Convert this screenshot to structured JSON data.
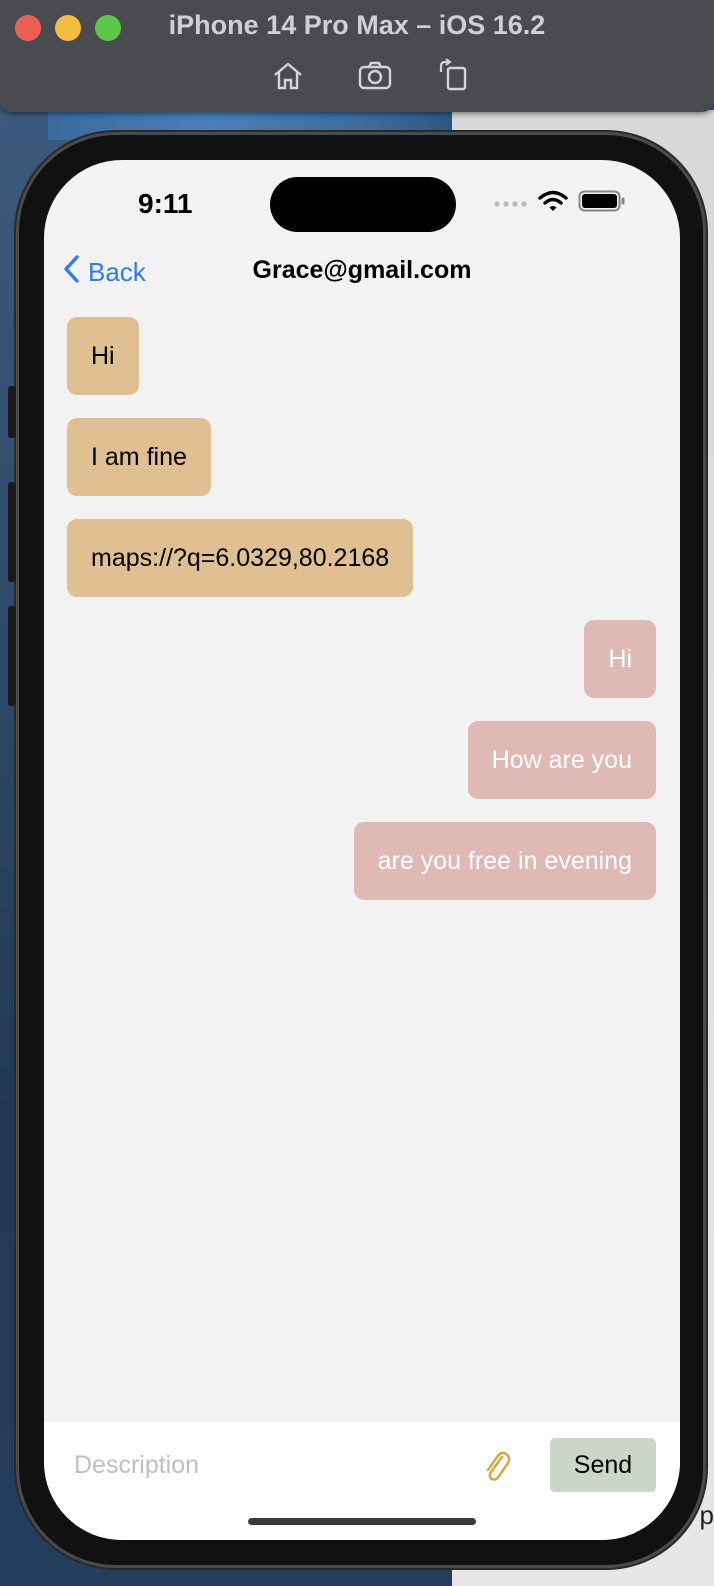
{
  "simulator": {
    "title": "iPhone 14 Pro Max – iOS 16.2",
    "toolbar_icons": [
      "home-icon",
      "screenshot-icon",
      "rotate-icon"
    ]
  },
  "status_bar": {
    "time": "9:11",
    "icons": [
      "cellular-dots-icon",
      "wifi-icon",
      "battery-icon"
    ]
  },
  "nav": {
    "back_label": "Back",
    "title": "Grace@gmail.com"
  },
  "messages": {
    "incoming": [
      {
        "text": "Hi"
      },
      {
        "text": "I am fine"
      },
      {
        "text": "maps://?q=6.0329,80.2168"
      }
    ],
    "outgoing": [
      {
        "text": "Hi"
      },
      {
        "text": "How are you"
      },
      {
        "text": "are you free in evening"
      }
    ]
  },
  "composer": {
    "placeholder": "Description",
    "value": "",
    "attach_icon": "paperclip-icon",
    "send_label": "Send"
  },
  "colors": {
    "incoming_bubble": "#e0c092",
    "outgoing_bubble": "#dfb9b4",
    "send_button": "#ccd6c6",
    "accent_link": "#2f7bf5",
    "attach_icon": "#e0a23c"
  },
  "desktop": {
    "corner_text": "p"
  }
}
